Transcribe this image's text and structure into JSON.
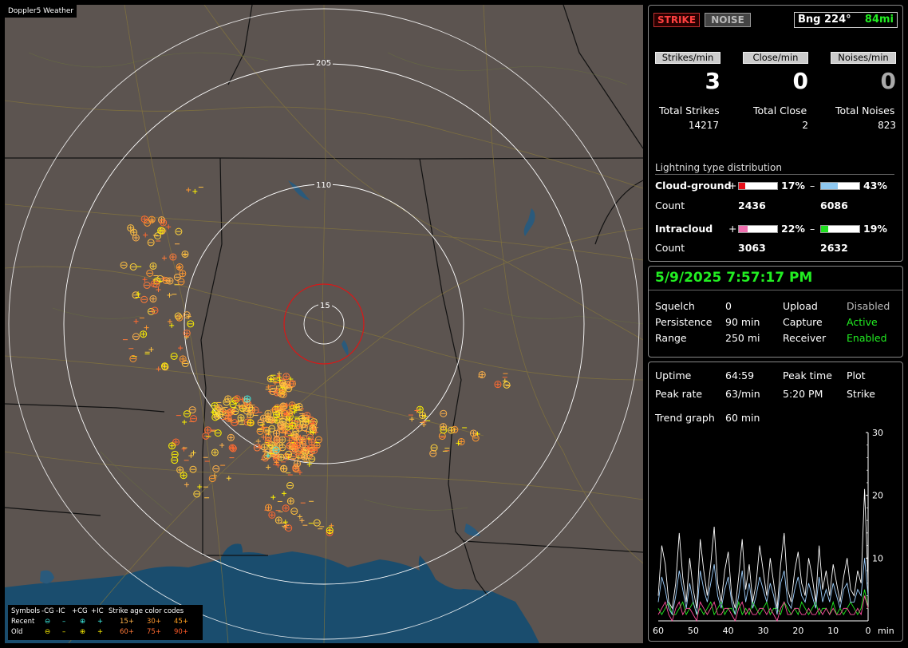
{
  "app": {
    "brand": "Doppler5 Weather"
  },
  "map": {
    "ring_labels": [
      "205",
      "110",
      "15"
    ],
    "legend": {
      "header": [
        "Symbols",
        "-CG",
        "-IC",
        "+CG",
        "+IC",
        "Strike age color codes"
      ],
      "recent_label": "Recent",
      "old_label": "Old",
      "recent_ages": [
        "15+",
        "30+",
        "45+"
      ],
      "old_ages": [
        "60+",
        "75+",
        "90+"
      ]
    }
  },
  "status": {
    "strike_button": "STRIKE",
    "noise_button": "NOISE",
    "bearing": "Bng 224°",
    "range": "84mi",
    "rate_labels": [
      "Strikes/min",
      "Close/min",
      "Noises/min"
    ],
    "rate_values": [
      "3",
      "0",
      "0"
    ],
    "total_labels": [
      "Total Strikes",
      "Total Close",
      "Total Noises"
    ],
    "total_values": [
      "14217",
      "2",
      "823"
    ]
  },
  "distribution": {
    "title": "Lightning type distribution",
    "cloud_ground_label": "Cloud-ground",
    "intracloud_label": "Intracloud",
    "count_label": "Count",
    "plus": "+",
    "minus": "–",
    "cg_plus_pct": "17%",
    "cg_minus_pct": "43%",
    "cg_plus_count": "2436",
    "cg_minus_count": "6086",
    "ic_plus_pct": "22%",
    "ic_minus_pct": "19%",
    "ic_plus_count": "3063",
    "ic_minus_count": "2632",
    "fractions": {
      "cg_plus": 0.17,
      "cg_minus": 0.43,
      "ic_plus": 0.22,
      "ic_minus": 0.19
    },
    "colors": {
      "cg_plus": "#e8101a",
      "cg_minus": "#8ec8f0",
      "ic_plus": "#f070b0",
      "ic_minus": "#20e020"
    }
  },
  "settings": {
    "datetime": "5/9/2025 7:57:17 PM",
    "squelch_label": "Squelch",
    "squelch_value": "0",
    "persistence_label": "Persistence",
    "persistence_value": "90 min",
    "range_label": "Range",
    "range_value": "250 mi",
    "upload_label": "Upload",
    "upload_value": "Disabled",
    "capture_label": "Capture",
    "capture_value": "Active",
    "receiver_label": "Receiver",
    "receiver_value": "Enabled"
  },
  "stats": {
    "uptime_label": "Uptime",
    "uptime_value": "64:59",
    "peak_time_label": "Peak time",
    "peak_time_value": "5:20 PM",
    "plot_label": "Plot",
    "plot_value": "Strike",
    "peak_rate_label": "Peak rate",
    "peak_rate_value": "63/min",
    "trend_label": "Trend graph",
    "trend_value": "60 min"
  },
  "chart_data": {
    "type": "line",
    "x_ticks": [
      "60",
      "50",
      "40",
      "30",
      "20",
      "10",
      "0"
    ],
    "x_unit": "min",
    "y_ticks": [
      "30",
      "20",
      "10"
    ],
    "ylim": [
      0,
      30
    ],
    "xlim": [
      60,
      0
    ],
    "series": [
      {
        "color": "#ffffff",
        "values": [
          4,
          12,
          9,
          3,
          2,
          6,
          14,
          7,
          3,
          10,
          5,
          2,
          13,
          8,
          4,
          9,
          15,
          6,
          3,
          8,
          11,
          4,
          2,
          7,
          13,
          5,
          9,
          3,
          6,
          12,
          8,
          4,
          10,
          6,
          2,
          9,
          14,
          5,
          3,
          8,
          11,
          6,
          4,
          10,
          7,
          3,
          12,
          5,
          8,
          4,
          9,
          6,
          3,
          7,
          10,
          5,
          4,
          8,
          6,
          21,
          6
        ]
      },
      {
        "color": "#9fd0ff",
        "values": [
          3,
          7,
          5,
          2,
          1,
          4,
          8,
          5,
          2,
          6,
          3,
          1,
          8,
          5,
          3,
          6,
          9,
          4,
          2,
          5,
          7,
          3,
          1,
          4,
          8,
          3,
          6,
          2,
          4,
          7,
          5,
          3,
          6,
          4,
          1,
          6,
          8,
          3,
          2,
          5,
          7,
          4,
          3,
          6,
          4,
          2,
          7,
          3,
          5,
          3,
          6,
          4,
          2,
          5,
          6,
          3,
          3,
          5,
          4,
          10,
          4
        ]
      },
      {
        "color": "#ff4fa0",
        "values": [
          1,
          2,
          3,
          1,
          0,
          2,
          3,
          1,
          2,
          2,
          1,
          0,
          3,
          2,
          1,
          2,
          3,
          1,
          1,
          2,
          2,
          1,
          0,
          2,
          3,
          1,
          2,
          1,
          1,
          2,
          2,
          1,
          2,
          1,
          0,
          2,
          3,
          1,
          1,
          2,
          2,
          1,
          1,
          2,
          1,
          1,
          2,
          1,
          2,
          1,
          2,
          1,
          1,
          2,
          2,
          1,
          1,
          2,
          1,
          4,
          2
        ]
      },
      {
        "color": "#22ee22",
        "values": [
          2,
          1,
          2,
          3,
          1,
          1,
          2,
          3,
          1,
          2,
          3,
          1,
          2,
          1,
          2,
          3,
          1,
          2,
          3,
          1,
          2,
          2,
          1,
          3,
          1,
          2,
          1,
          3,
          2,
          1,
          2,
          3,
          1,
          2,
          2,
          1,
          3,
          2,
          1,
          2,
          1,
          3,
          2,
          1,
          2,
          3,
          1,
          2,
          2,
          1,
          3,
          1,
          2,
          1,
          2,
          3,
          2,
          1,
          2,
          5,
          2
        ]
      }
    ]
  }
}
